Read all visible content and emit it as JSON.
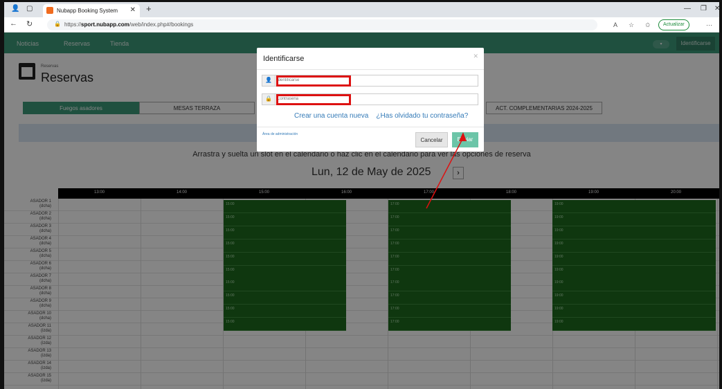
{
  "browser": {
    "tab_title": "Nubapp Booking System",
    "url_prefix": "https://",
    "url_host": "sport.nubapp.com",
    "url_path": "/web/index.php#/bookings",
    "update_label": "Actualizar"
  },
  "topnav": {
    "items": [
      "Noticias",
      "Reservas",
      "Tienda"
    ],
    "login_label": "Identificarse"
  },
  "header": {
    "breadcrumb": "Reservas",
    "title": "Reservas"
  },
  "categories": [
    "Fuegos asadores",
    "MESAS TERRAZA",
    "ACT. COMPLEMENTARIAS 2024-2025"
  ],
  "calendar": {
    "instruction": "Arrastra y suelta un slot en el calendario o haz clic en el calendario para ver las opciones de reserva",
    "date": "Lun, 12 de May de 2025",
    "hours": [
      "13:00",
      "14:00",
      "15:00",
      "16:00",
      "17:00",
      "18:00",
      "19:00",
      "20:00"
    ],
    "rows": [
      {
        "name": "ASADOR 1",
        "side": "(dcha)"
      },
      {
        "name": "ASADOR 2",
        "side": "(dcha)"
      },
      {
        "name": "ASADOR 3",
        "side": "(dcha)"
      },
      {
        "name": "ASADOR 4",
        "side": "(dcha)"
      },
      {
        "name": "ASADOR 5",
        "side": "(dcha)"
      },
      {
        "name": "ASADOR 6",
        "side": "(dcha)"
      },
      {
        "name": "ASADOR 7",
        "side": "(dcha)"
      },
      {
        "name": "ASADOR 8",
        "side": "(dcha)"
      },
      {
        "name": "ASADOR 9",
        "side": "(dcha)"
      },
      {
        "name": "ASADOR 10",
        "side": "(dcha)"
      },
      {
        "name": "ASADOR 11",
        "side": "(izda)"
      },
      {
        "name": "ASADOR 12",
        "side": "(izda)"
      },
      {
        "name": "ASADOR 13",
        "side": "(izda)"
      },
      {
        "name": "ASADOR 14",
        "side": "(izda)"
      },
      {
        "name": "ASADOR 15",
        "side": "(izda)"
      }
    ],
    "slot_labels": [
      "15:00",
      "17:00",
      "19:00"
    ]
  },
  "modal": {
    "title": "Identificarse",
    "user_placeholder": "Identificarse",
    "password_placeholder": "Contraseña",
    "create_account": "Crear una cuenta nueva",
    "forgot_password": "¿Has olvidado tu contraseña?",
    "admin_area": "Área de administración",
    "cancel": "Cancelar",
    "send": "Enviar"
  },
  "colors": {
    "brand_green": "#3c9a7a",
    "slot_green": "#1e6a1e",
    "annotation_red": "#dd1111"
  }
}
